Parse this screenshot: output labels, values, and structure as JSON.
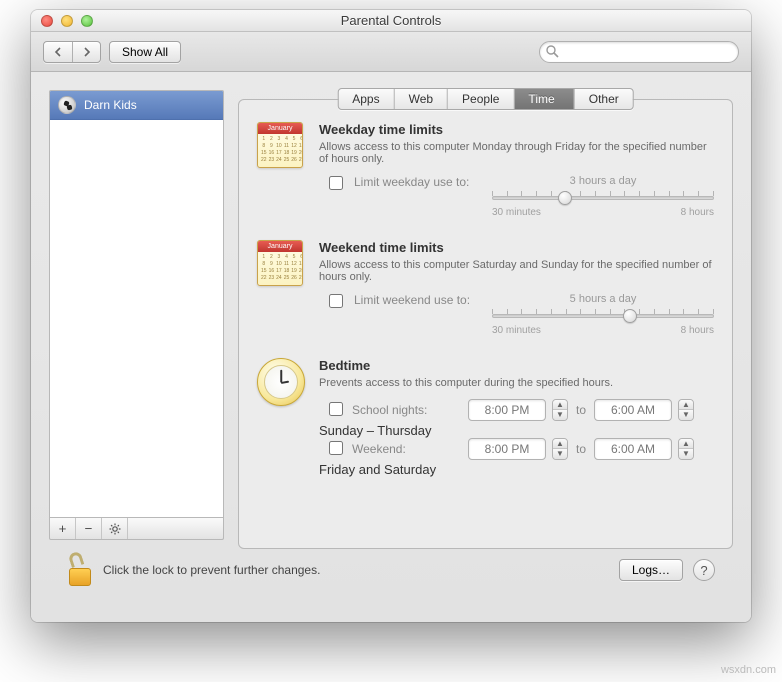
{
  "window": {
    "title": "Parental Controls"
  },
  "toolbar": {
    "show_all": "Show All",
    "search_placeholder": ""
  },
  "sidebar": {
    "users": [
      {
        "name": "Darn Kids"
      }
    ],
    "actions": {
      "add": "+",
      "remove": "−",
      "gear": "✱"
    }
  },
  "tabs": [
    {
      "label": "Apps",
      "active": false
    },
    {
      "label": "Web",
      "active": false
    },
    {
      "label": "People",
      "active": false
    },
    {
      "label": "Time Limits",
      "active": true
    },
    {
      "label": "Other",
      "active": false
    }
  ],
  "weekday": {
    "title": "Weekday time limits",
    "desc": "Allows access to this computer Monday through Friday for the specified number of hours only.",
    "checkbox_label": "Limit weekday use to:",
    "value_label": "3 hours a day",
    "min_label": "30 minutes",
    "max_label": "8 hours",
    "month": "January",
    "slider_percent": 33
  },
  "weekend": {
    "title": "Weekend time limits",
    "desc": "Allows access to this computer Saturday and Sunday for the specified number of hours only.",
    "checkbox_label": "Limit weekend use to:",
    "value_label": "5 hours a day",
    "min_label": "30 minutes",
    "max_label": "8 hours",
    "month": "January",
    "slider_percent": 62
  },
  "bedtime": {
    "title": "Bedtime",
    "desc": "Prevents access to this computer during the specified hours.",
    "school": {
      "label": "School nights:",
      "sub": "Sunday – Thursday",
      "from": "8:00 PM",
      "to_word": "to",
      "to": "6:00 AM"
    },
    "weekend": {
      "label": "Weekend:",
      "sub": "Friday and Saturday",
      "from": "8:00 PM",
      "to_word": "to",
      "to": "6:00 AM"
    }
  },
  "footer": {
    "lock_text": "Click the lock to prevent further changes.",
    "logs_label": "Logs…",
    "help": "?"
  },
  "watermark": "wsxdn.com"
}
